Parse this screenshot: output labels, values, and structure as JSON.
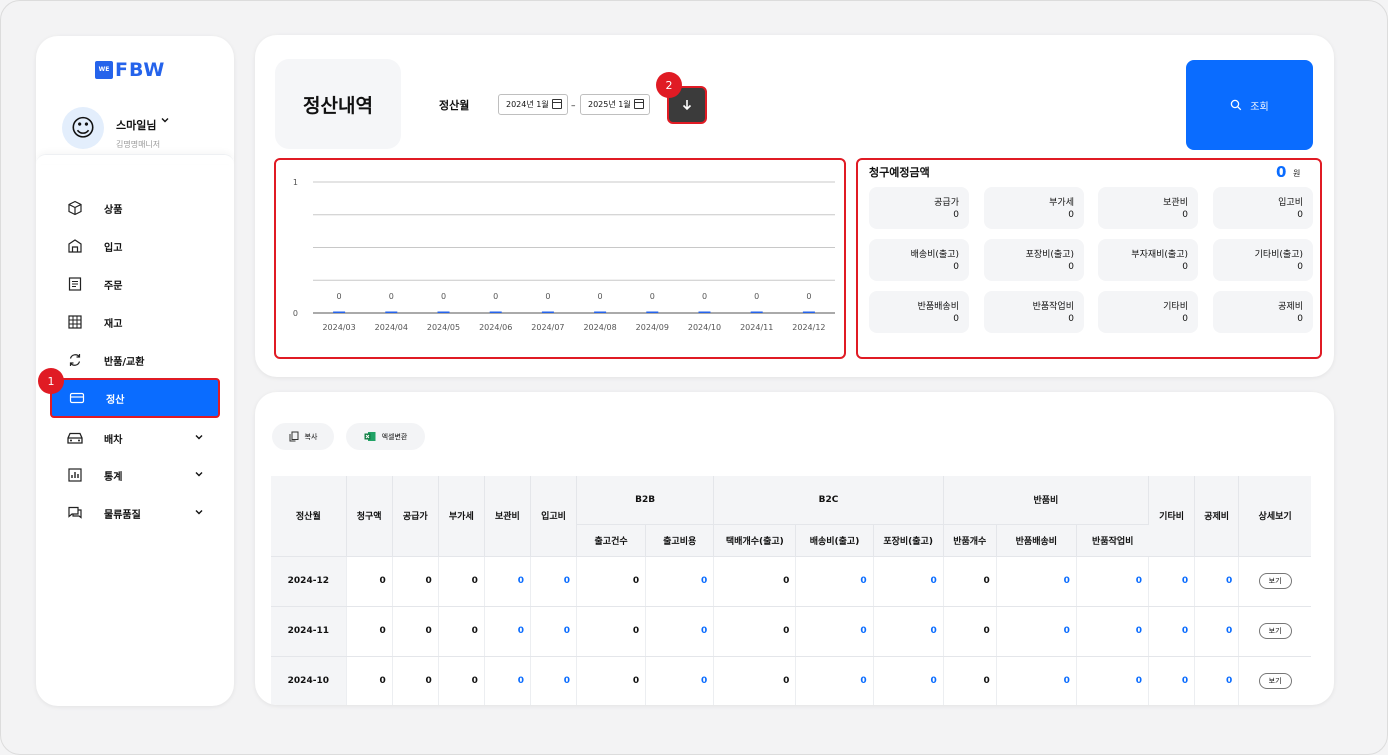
{
  "brand": {
    "logo_mark": "WE",
    "logo_text": "FBW",
    "color": "#2563eb"
  },
  "profile": {
    "name": "스마일님",
    "role": "김명명매니저",
    "avatar": "smiling-face"
  },
  "sidebar": {
    "items": [
      {
        "label": "상품",
        "icon": "box-icon"
      },
      {
        "label": "입고",
        "icon": "warehouse-icon"
      },
      {
        "label": "주문",
        "icon": "order-icon"
      },
      {
        "label": "재고",
        "icon": "grid-icon"
      },
      {
        "label": "반품/교환",
        "icon": "refresh-icon"
      },
      {
        "label": "정산",
        "icon": "card-icon"
      },
      {
        "label": "배차",
        "icon": "car-icon"
      },
      {
        "label": "통계",
        "icon": "chart-icon"
      },
      {
        "label": "물류품질",
        "icon": "chat-icon"
      }
    ]
  },
  "annotations": {
    "badge1": "1",
    "badge2": "2"
  },
  "header": {
    "title": "정산내역",
    "period_label": "정산월",
    "date_from": "2024년 1월",
    "date_to": "2025년 1월",
    "dash": "–",
    "search_label": "조회"
  },
  "chart_data": {
    "type": "bar",
    "categories": [
      "2024/03",
      "2024/04",
      "2024/05",
      "2024/06",
      "2024/07",
      "2024/08",
      "2024/09",
      "2024/10",
      "2024/11",
      "2024/12"
    ],
    "values": [
      0,
      0,
      0,
      0,
      0,
      0,
      0,
      0,
      0,
      0
    ],
    "ytick_labels": [
      "1",
      "0"
    ],
    "ylim": [
      0,
      1
    ],
    "grid": true,
    "bar_color": "#2563eb"
  },
  "amounts": {
    "title": "청구예정금액",
    "total": "0",
    "unit": "원",
    "tiles": [
      {
        "label": "공급가",
        "value": "0"
      },
      {
        "label": "부가세",
        "value": "0"
      },
      {
        "label": "보관비",
        "value": "0"
      },
      {
        "label": "입고비",
        "value": "0"
      },
      {
        "label": "배송비(출고)",
        "value": "0"
      },
      {
        "label": "포장비(출고)",
        "value": "0"
      },
      {
        "label": "부자재비(출고)",
        "value": "0"
      },
      {
        "label": "기타비(출고)",
        "value": "0"
      },
      {
        "label": "반품배송비",
        "value": "0"
      },
      {
        "label": "반품작업비",
        "value": "0"
      },
      {
        "label": "기타비",
        "value": "0"
      },
      {
        "label": "공제비",
        "value": "0"
      }
    ]
  },
  "actions": {
    "copy_label": "복사",
    "excel_label": "엑셀변환"
  },
  "table": {
    "headers": {
      "month": "정산월",
      "billed": "청구액",
      "supply": "공급가",
      "vat": "부가세",
      "storage": "보관비",
      "inbound": "입고비",
      "b2b": "B2B",
      "b2c": "B2C",
      "returns": "반품비",
      "etc": "기타비",
      "deduct": "공제비",
      "detail": "상세보기",
      "b2b_count": "출고건수",
      "b2b_cost": "출고비용",
      "b2c_parcel": "택배개수(출고)",
      "b2c_ship": "배송비(출고)",
      "b2c_pack": "포장비(출고)",
      "ret_count": "반품개수",
      "ret_ship": "반품배송비",
      "ret_work": "반품작업비"
    },
    "rows": [
      {
        "month": "2024-12",
        "cells": [
          "0",
          "0",
          "0",
          "0",
          "0",
          "0",
          "0",
          "0",
          "0",
          "0",
          "0",
          "0",
          "0",
          "0",
          "0"
        ],
        "button": "보기"
      },
      {
        "month": "2024-11",
        "cells": [
          "0",
          "0",
          "0",
          "0",
          "0",
          "0",
          "0",
          "0",
          "0",
          "0",
          "0",
          "0",
          "0",
          "0",
          "0"
        ],
        "button": "보기"
      },
      {
        "month": "2024-10",
        "cells": [
          "0",
          "0",
          "0",
          "0",
          "0",
          "0",
          "0",
          "0",
          "0",
          "0",
          "0",
          "0",
          "0",
          "0",
          "0"
        ],
        "button": "보기"
      }
    ]
  }
}
